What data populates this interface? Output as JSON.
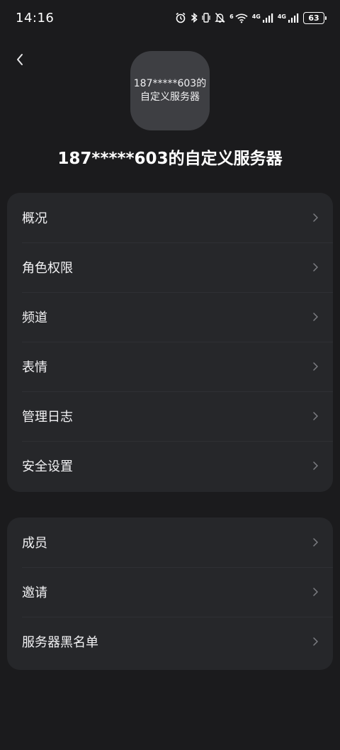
{
  "status_bar": {
    "time": "14:16",
    "network_1": "4G",
    "network_2": "4G",
    "wifi_label": "6",
    "battery": "63",
    "icons": [
      "alarm-icon",
      "bluetooth-icon",
      "vibrate-icon",
      "mute-icon",
      "wifi-icon",
      "signal-icon",
      "signal-icon",
      "battery-icon"
    ]
  },
  "header": {
    "back_icon": "chevron-left-icon",
    "avatar_line_1": "187*****603的",
    "avatar_line_2": "自定义服务器",
    "title": "187*****603的自定义服务器"
  },
  "menu_group_1": [
    {
      "label": "概况"
    },
    {
      "label": "角色权限"
    },
    {
      "label": "频道"
    },
    {
      "label": "表情"
    },
    {
      "label": "管理日志"
    },
    {
      "label": "安全设置"
    }
  ],
  "menu_group_2": [
    {
      "label": "成员"
    },
    {
      "label": "邀请"
    },
    {
      "label": "服务器黑名单"
    }
  ],
  "colors": {
    "background": "#1b1b1d",
    "card": "#26272a",
    "avatar": "#3e3f43",
    "text": "#f2f2f4",
    "chevron": "#7c7d82"
  }
}
